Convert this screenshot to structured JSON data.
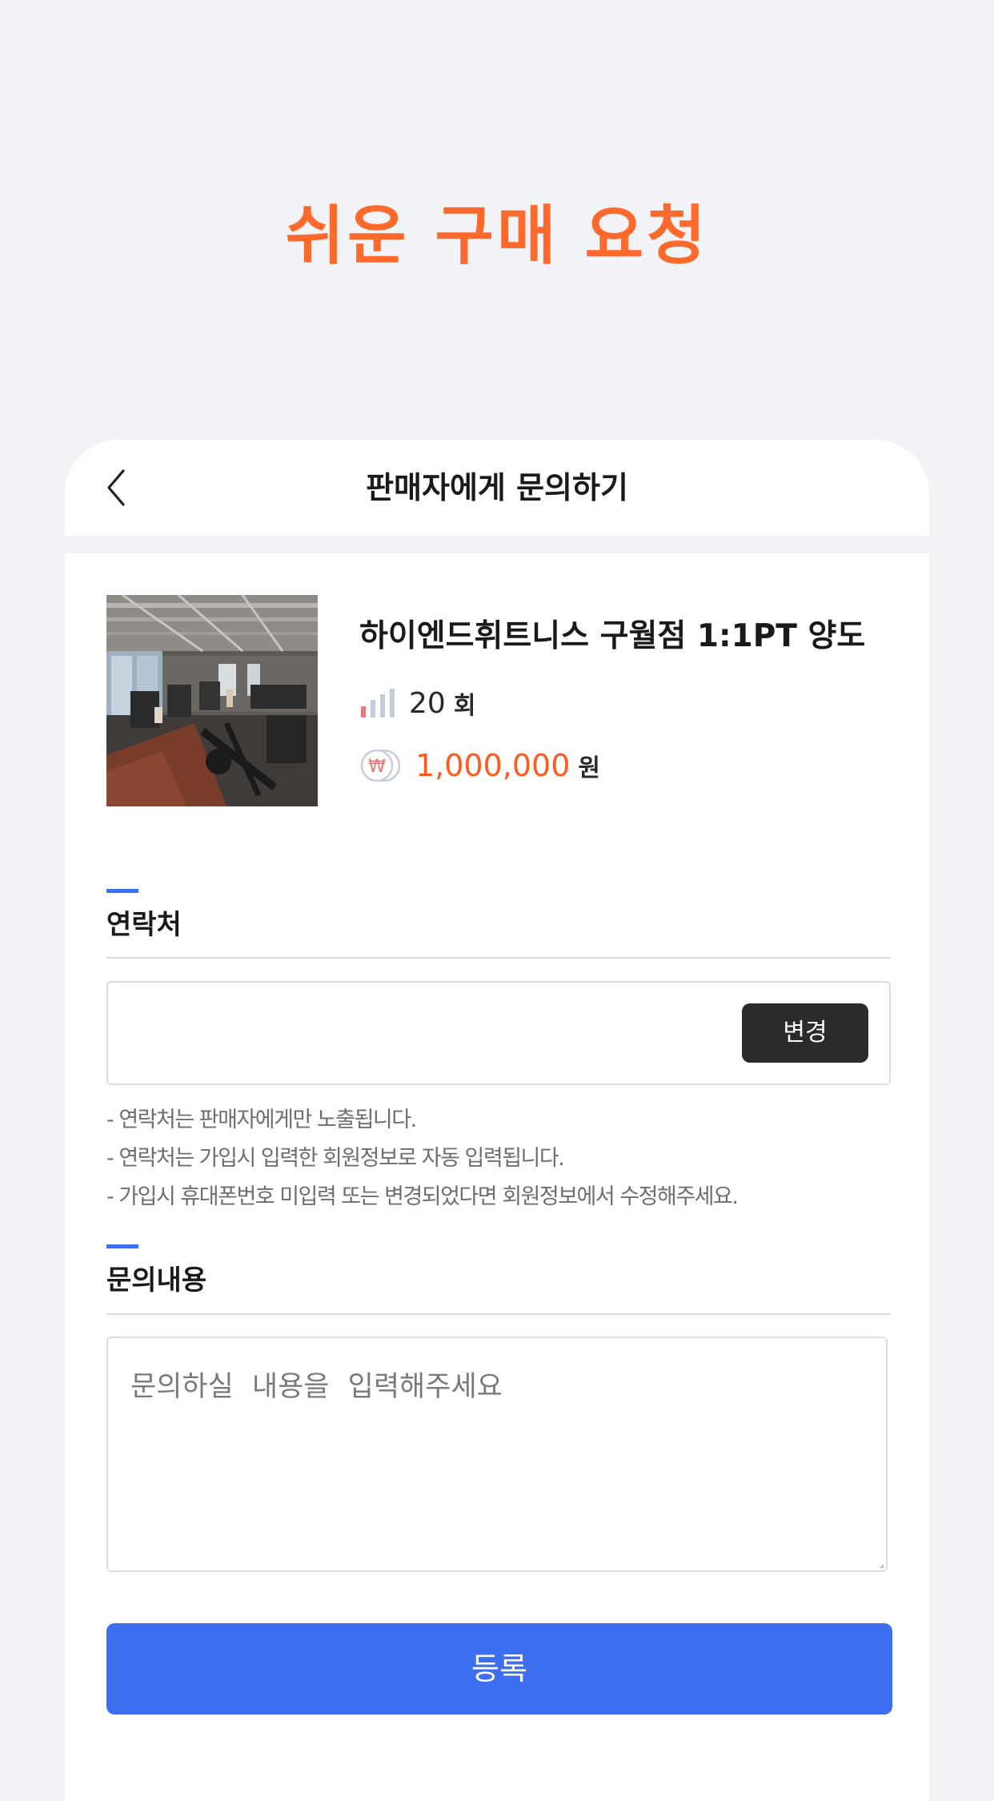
{
  "promo": {
    "title": "쉬운 구매 요청"
  },
  "header": {
    "title": "판매자에게 문의하기",
    "back_icon": "chevron-left-icon"
  },
  "product": {
    "name": "하이엔드휘트니스 구월점 1:1PT 양도",
    "count_icon": "signal-bars-icon",
    "count_value": "20",
    "count_unit": "회",
    "price_icon": "won-coin-icon",
    "price_value": "1,000,000",
    "price_unit": "원",
    "image_subject": "gym-interior-photo"
  },
  "contact": {
    "label": "연락처",
    "value": "",
    "change_label": "변경",
    "notes": [
      "- 연락처는 판매자에게만 노출됩니다.",
      "- 연락처는 가입시 입력한 회원정보로 자동 입력됩니다.",
      "- 가입시 휴대폰번호 미입력 또는 변경되었다면 회원정보에서 수정해주세요."
    ]
  },
  "inquiry": {
    "label": "문의내용",
    "placeholder": "문의하실  내용을  입력해주세요"
  },
  "submit": {
    "label": "등록"
  },
  "colors": {
    "promo_title": "#ff6a2c",
    "accent": "#3d6ff0",
    "price": "#ff5a1f",
    "change_button": "#2b2b2b",
    "page_background": "#f2f3f6"
  }
}
